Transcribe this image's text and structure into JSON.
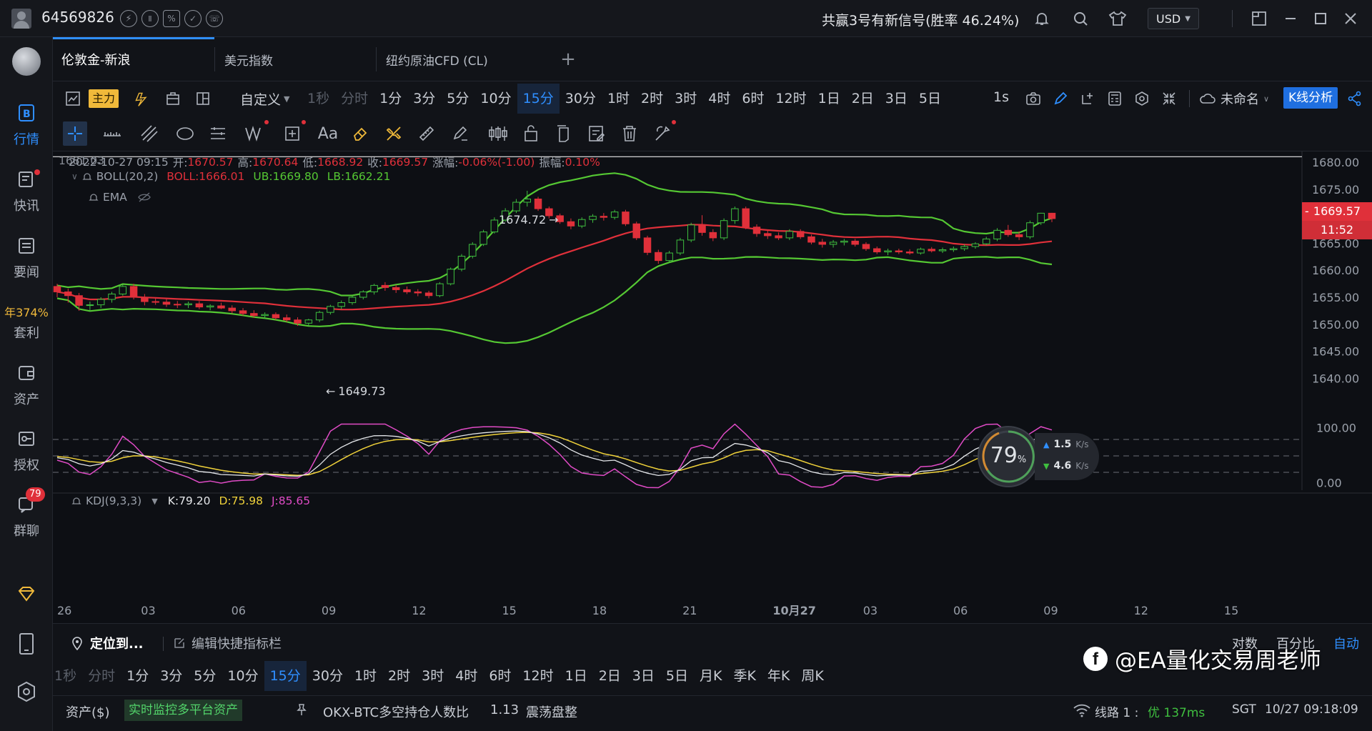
{
  "topbar": {
    "user_id": "64569826",
    "signal_text": "共赢3号有新信号(胜率 46.24%)",
    "currency": "USD"
  },
  "sidebar": {
    "items": [
      {
        "label": "行情"
      },
      {
        "label": "快讯"
      },
      {
        "label": "要闻"
      },
      {
        "label": "套利",
        "badge_text": "年374%"
      },
      {
        "label": "资产"
      },
      {
        "label": "授权"
      },
      {
        "label": "群聊",
        "count": "79"
      }
    ]
  },
  "tabs": [
    {
      "label": "伦敦金-新浪"
    },
    {
      "label": "美元指数"
    },
    {
      "label": "纽约原油CFD (CL)"
    }
  ],
  "toolbar": {
    "main_label": "主力",
    "custom_label": "自定义",
    "timeframes": [
      "1秒",
      "分时",
      "1分",
      "3分",
      "5分",
      "10分",
      "15分",
      "30分",
      "1时",
      "2时",
      "3时",
      "4时",
      "6时",
      "12时",
      "1日",
      "2日",
      "3日",
      "5日"
    ],
    "selected_timeframe": "15分",
    "interval_label": "1s",
    "unnamed_label": "未命名",
    "kline_button": "K线分析"
  },
  "drawing_tools": {
    "text_tool": "Aa"
  },
  "ohlc_info": {
    "price_overlay": "1681.03",
    "datetime": "2022-10-27 09:15",
    "open_label": "开:",
    "open": "1670.57",
    "high_label": "高:",
    "high": "1670.64",
    "low_label": "低:",
    "low": "1668.92",
    "close_label": "收:",
    "close": "1669.57",
    "change_label": "涨幅:",
    "change": "-0.06%(-1.00)",
    "amp_label": "振幅:",
    "amplitude": "0.10%"
  },
  "indicators": {
    "boll": {
      "name": "BOLL(20,2)",
      "boll_text": "BOLL:1666.01",
      "ub_text": "UB:1669.80",
      "lb_text": "LB:1662.21"
    },
    "ema": {
      "name": "EMA"
    },
    "kdj": {
      "name": "KDJ(9,3,3)",
      "k_text": "K:79.20",
      "d_text": "D:75.98",
      "j_text": "J:85.65"
    }
  },
  "annotations": {
    "max_label": "1674.72",
    "min_label": "1649.73"
  },
  "price_panel": {
    "current_price": "1669.57",
    "countdown": "11:52"
  },
  "speed_widget": {
    "percent": "79",
    "percent_sign": "%",
    "up": "1.5",
    "down": "4.6",
    "unit": "K/s"
  },
  "chart_data": {
    "type": "candlestick",
    "price_axis": {
      "ticks": [
        "1680.00",
        "1675.00",
        "1670.00",
        "1665.00",
        "1660.00",
        "1655.00",
        "1650.00",
        "1645.00",
        "1640.00"
      ],
      "ylim": [
        1637,
        1682
      ]
    },
    "kdj_axis": {
      "ticks": [
        "100.00",
        "0.00"
      ]
    },
    "x_ticks": [
      "26",
      "03",
      "06",
      "09",
      "12",
      "15",
      "18",
      "21",
      "10月27",
      "03",
      "06",
      "09",
      "12",
      "15"
    ],
    "candles": [
      [
        1657,
        1657.5,
        1655,
        1656
      ],
      [
        1656,
        1656.6,
        1654,
        1655.3
      ],
      [
        1655.3,
        1655.8,
        1652.5,
        1653.5
      ],
      [
        1653.5,
        1654.2,
        1652.4,
        1653.6
      ],
      [
        1653.6,
        1655,
        1653,
        1654.6
      ],
      [
        1654.6,
        1656,
        1654,
        1655.6
      ],
      [
        1655.6,
        1657.4,
        1655.3,
        1657
      ],
      [
        1657,
        1657.5,
        1654.6,
        1655
      ],
      [
        1655,
        1655.6,
        1653.5,
        1654.2
      ],
      [
        1654.2,
        1654.8,
        1653.6,
        1654.1
      ],
      [
        1654.1,
        1654.7,
        1653.2,
        1653.7
      ],
      [
        1653.7,
        1654.3,
        1653,
        1653.6
      ],
      [
        1653.6,
        1654.2,
        1653,
        1653.8
      ],
      [
        1653.8,
        1654.3,
        1652.8,
        1653.2
      ],
      [
        1653.2,
        1653.7,
        1652.6,
        1653.4
      ],
      [
        1653.4,
        1654,
        1652.8,
        1653
      ],
      [
        1653,
        1653.5,
        1652,
        1652.5
      ],
      [
        1652.5,
        1653,
        1651.6,
        1652
      ],
      [
        1652,
        1652.6,
        1651.2,
        1651.6
      ],
      [
        1651.6,
        1652.2,
        1651,
        1651.8
      ],
      [
        1651.8,
        1652.2,
        1650.8,
        1651.2
      ],
      [
        1651.2,
        1651.8,
        1650.4,
        1650.8
      ],
      [
        1650.8,
        1651.3,
        1649.7,
        1650.2
      ],
      [
        1650.2,
        1651,
        1649.8,
        1650.8
      ],
      [
        1650.8,
        1652.5,
        1650.4,
        1652.2
      ],
      [
        1652.2,
        1653.6,
        1651.8,
        1653.3
      ],
      [
        1653.3,
        1654.4,
        1652.8,
        1654
      ],
      [
        1654,
        1655.3,
        1653.6,
        1655
      ],
      [
        1655,
        1656.3,
        1654.6,
        1656
      ],
      [
        1656,
        1657.5,
        1655.5,
        1657.2
      ],
      [
        1657.2,
        1657.8,
        1656.2,
        1656.8
      ],
      [
        1656.8,
        1657.3,
        1655.8,
        1656.4
      ],
      [
        1656.4,
        1657,
        1655.6,
        1656
      ],
      [
        1656,
        1656.5,
        1655.2,
        1655.8
      ],
      [
        1655.8,
        1656.2,
        1654.8,
        1655.3
      ],
      [
        1655.3,
        1657.8,
        1655,
        1657.5
      ],
      [
        1657.5,
        1660.5,
        1657.2,
        1660.2
      ],
      [
        1660.2,
        1663,
        1659.8,
        1662.6
      ],
      [
        1662.6,
        1665.2,
        1662.2,
        1664.8
      ],
      [
        1664.8,
        1667.5,
        1664.5,
        1667.1
      ],
      [
        1667.1,
        1669.8,
        1666.8,
        1669.3
      ],
      [
        1669.3,
        1671.5,
        1669,
        1671
      ],
      [
        1671,
        1673.2,
        1670.6,
        1672.6
      ],
      [
        1672.6,
        1674.72,
        1671.8,
        1673.2
      ],
      [
        1673.2,
        1673.6,
        1671,
        1671.4
      ],
      [
        1671.4,
        1671.8,
        1669.6,
        1670.1
      ],
      [
        1670.1,
        1670.5,
        1668.6,
        1669
      ],
      [
        1669,
        1669.6,
        1667.6,
        1668.2
      ],
      [
        1668.2,
        1669.8,
        1667.8,
        1669.4
      ],
      [
        1669.4,
        1670.4,
        1668.8,
        1670
      ],
      [
        1670,
        1670.6,
        1669.2,
        1669.8
      ],
      [
        1669.8,
        1671.2,
        1669.4,
        1670.8
      ],
      [
        1670.8,
        1671.2,
        1668.2,
        1668.6
      ],
      [
        1668.6,
        1669,
        1665.6,
        1666
      ],
      [
        1666,
        1666.4,
        1662.8,
        1663.3
      ],
      [
        1663.3,
        1663.8,
        1661.2,
        1661.8
      ],
      [
        1661.8,
        1663.6,
        1661.4,
        1663.2
      ],
      [
        1663.2,
        1666,
        1662.8,
        1665.6
      ],
      [
        1665.6,
        1668.8,
        1665.2,
        1668.4
      ],
      [
        1668.4,
        1670.2,
        1666.4,
        1667
      ],
      [
        1667,
        1667.6,
        1665.4,
        1666
      ],
      [
        1666,
        1669.6,
        1665.6,
        1669.2
      ],
      [
        1669.2,
        1671.8,
        1668.6,
        1671.4
      ],
      [
        1671.4,
        1671.8,
        1667.6,
        1668
      ],
      [
        1668,
        1668.5,
        1666.2,
        1666.8
      ],
      [
        1666.8,
        1667.4,
        1665.8,
        1666.4
      ],
      [
        1666.4,
        1667,
        1665.6,
        1666
      ],
      [
        1666,
        1667.6,
        1665.6,
        1667.2
      ],
      [
        1667.2,
        1667.6,
        1665.8,
        1666.2
      ],
      [
        1666.2,
        1666.6,
        1664.8,
        1665.2
      ],
      [
        1665.2,
        1665.8,
        1664.2,
        1664.8
      ],
      [
        1664.8,
        1665.6,
        1664.2,
        1665.2
      ],
      [
        1665.2,
        1665.8,
        1664.6,
        1665.4
      ],
      [
        1665.4,
        1665.8,
        1664.4,
        1664.8
      ],
      [
        1664.8,
        1665.2,
        1663.6,
        1664
      ],
      [
        1664,
        1664.4,
        1663,
        1663.4
      ],
      [
        1663.4,
        1664,
        1662.8,
        1663.6
      ],
      [
        1663.6,
        1664,
        1663,
        1663.4
      ],
      [
        1663.4,
        1663.9,
        1662.9,
        1663.2
      ],
      [
        1663.2,
        1664.2,
        1662.9,
        1663.9
      ],
      [
        1663.9,
        1664.3,
        1663.3,
        1663.6
      ],
      [
        1663.6,
        1664.2,
        1663.2,
        1663.8
      ],
      [
        1663.8,
        1664.4,
        1663.4,
        1664
      ],
      [
        1664,
        1664.8,
        1663.6,
        1664.4
      ],
      [
        1664.4,
        1665.2,
        1664,
        1664.9
      ],
      [
        1664.9,
        1666.2,
        1664.6,
        1665.8
      ],
      [
        1665.8,
        1667.8,
        1665.4,
        1667.4
      ],
      [
        1667.4,
        1668.4,
        1666.2,
        1666.6
      ],
      [
        1666.6,
        1667.2,
        1665.6,
        1666.2
      ],
      [
        1666.2,
        1669.2,
        1665.8,
        1668.8
      ],
      [
        1668.8,
        1670.64,
        1668.4,
        1670.57
      ],
      [
        1670.57,
        1670.64,
        1668.92,
        1669.57
      ]
    ]
  },
  "bottom": {
    "locate_label": "定位到...",
    "edit_label": "编辑快捷指标栏",
    "scale_options": [
      "对数",
      "百分比",
      "自动"
    ],
    "selected_scale": "自动",
    "timeframes": [
      "1秒",
      "分时",
      "1分",
      "3分",
      "5分",
      "10分",
      "15分",
      "30分",
      "1时",
      "2时",
      "3时",
      "4时",
      "6时",
      "12时",
      "1日",
      "2日",
      "3日",
      "5日",
      "月K",
      "季K",
      "年K",
      "周K"
    ],
    "selected_timeframe": "15分",
    "assets_label": "资产($)",
    "monitor_label": "实时监控多平台资产",
    "ticker_text": "OKX-BTC多空持仓人数比",
    "ticker_value": "1.13",
    "ticker_status": "震荡盘整",
    "line_label": "线路 1 :",
    "line_quality": "优 137ms",
    "timezone": "SGT",
    "clock": "10/27 09:18:09"
  },
  "watermark": {
    "text": "@EA量化交易周老师"
  },
  "colors": {
    "up": "#3fbf3f",
    "down": "#e0303a",
    "boll_mid": "#e0303a",
    "boll_band": "#55c833",
    "accent": "#2f8fff"
  }
}
